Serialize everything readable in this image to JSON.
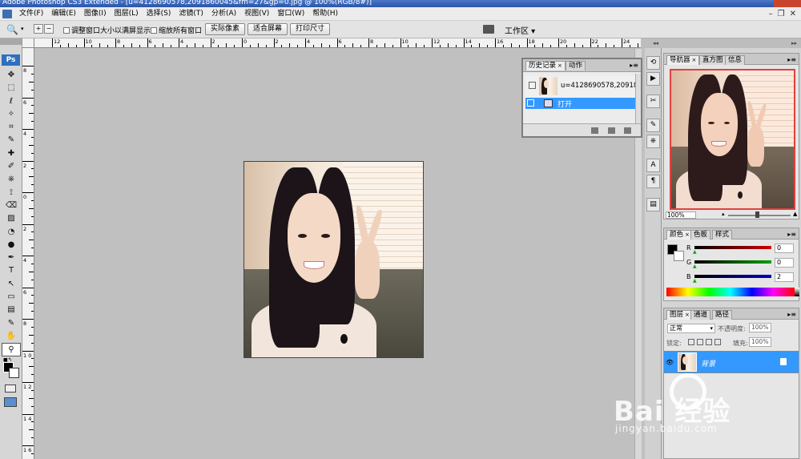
{
  "window": {
    "title": "Adobe Photoshop CS3 Extended - [u=4128690578,2091860045&fm=27&gp=0.jpg @ 100%(RGB/8#)]"
  },
  "menu": [
    "文件(F)",
    "编辑(E)",
    "图像(I)",
    "图层(L)",
    "选择(S)",
    "滤镜(T)",
    "分析(A)",
    "视图(V)",
    "窗口(W)",
    "帮助(H)"
  ],
  "options": {
    "resize_windows_label": "调整窗口大小以满屏显示",
    "zoom_all_windows_label": "缩放所有窗口",
    "actual_pixels_label": "实际像素",
    "fit_screen_label": "适合屏幕",
    "print_size_label": "打印尺寸",
    "workspace_label": "工作区"
  },
  "toolbox": {
    "logo": "Ps",
    "tools": [
      "✥",
      "⬚",
      "ℓ",
      "✧",
      "⌗",
      "✎",
      "✚",
      "✐",
      "⎈",
      "⟟",
      "⌫",
      "▨",
      "◔",
      "●",
      "✒",
      "T",
      "↖",
      "▭",
      "▤",
      "✎",
      "✋",
      "⚲"
    ],
    "active_tool_icon": "zoom-icon"
  },
  "ruler": {
    "top_labels": [
      "12",
      "10",
      "8",
      "6",
      "4",
      "2",
      "0",
      "2",
      "4",
      "6",
      "8",
      "10",
      "12",
      "14",
      "16",
      "18",
      "20",
      "22",
      "24"
    ],
    "left_labels": [
      "8",
      "6",
      "4",
      "2",
      "0",
      "2",
      "4",
      "6",
      "8",
      "1 0",
      "1 2",
      "1 4",
      "1 6"
    ]
  },
  "history": {
    "tabs": [
      "历史记录",
      "动作"
    ],
    "snapshot_name": "u=4128690578,209186...",
    "step_label": "打开"
  },
  "navigator": {
    "tabs": [
      "导航器",
      "直方图",
      "信息"
    ],
    "zoom": "100%"
  },
  "color": {
    "tabs": [
      "颜色",
      "色板",
      "样式"
    ],
    "r_label": "R",
    "g_label": "G",
    "b_label": "B",
    "r": "0",
    "g": "0",
    "b": "2",
    "r_color": "#d00000",
    "g_color": "#00a000",
    "b_color": "#0000c0"
  },
  "layers": {
    "tabs": [
      "图层",
      "通道",
      "路径"
    ],
    "blend_mode": "正常",
    "opacity_label": "不透明度:",
    "opacity": "100%",
    "lock_label": "锁定:",
    "fill_label": "填充:",
    "fill": "100%",
    "layer_name": "背景"
  },
  "watermark": {
    "brand": "Bai  经验",
    "url": "jingyan.baidu.com"
  },
  "colors": {
    "selection": "#3399ff",
    "titlebar": "#2a55a8"
  }
}
